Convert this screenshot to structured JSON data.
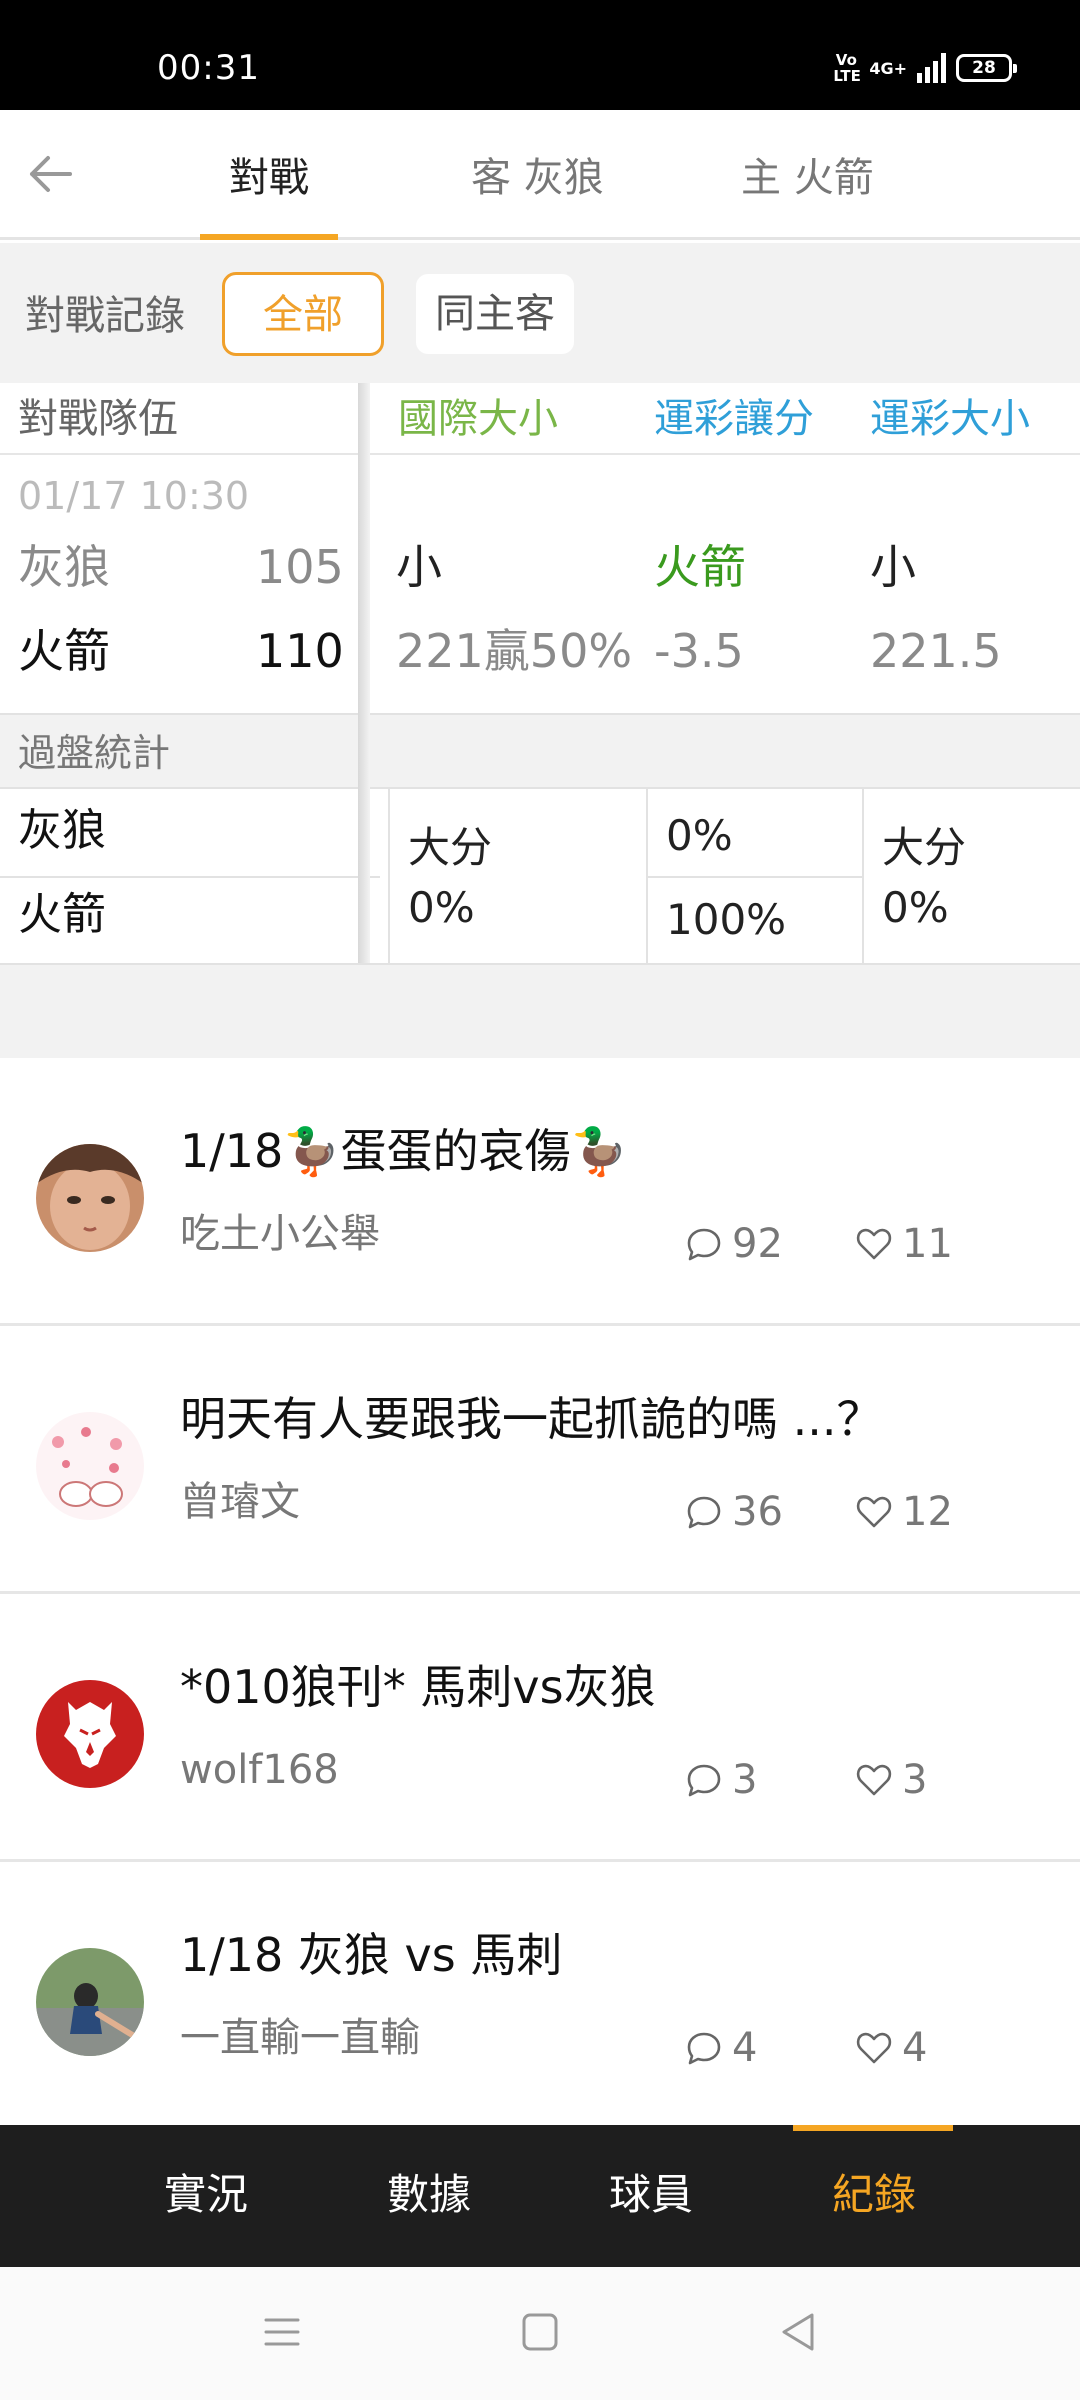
{
  "status_bar": {
    "time": "00:31",
    "volte": "Vo LTE",
    "network": "4G+",
    "battery": "28"
  },
  "header": {
    "tabs": [
      {
        "label": "對戰",
        "active": true
      },
      {
        "label": "客 灰狼",
        "active": false
      },
      {
        "label": "主 火箭",
        "active": false
      }
    ]
  },
  "filters": {
    "label": "對戰記錄",
    "options": [
      {
        "label": "全部",
        "selected": true
      },
      {
        "label": "同主客",
        "selected": false
      }
    ]
  },
  "table": {
    "headers": [
      "對戰隊伍",
      "國際大小",
      "運彩讓分",
      "運彩大小"
    ],
    "game": {
      "date": "01/17 10:30",
      "away": {
        "team": "灰狼",
        "score": "105"
      },
      "home": {
        "team": "火箭",
        "score": "110"
      },
      "intl_ou": {
        "result": "小",
        "line": "221贏50%"
      },
      "spread": {
        "result": "火箭",
        "line": "-3.5"
      },
      "ou": {
        "result": "小",
        "line": "221.5"
      }
    },
    "summary": {
      "title": "過盤統計",
      "teams": [
        "灰狼",
        "火箭"
      ],
      "intl_ou": {
        "label": "大分",
        "pct": "0%"
      },
      "spread": {
        "away_pct": "0%",
        "home_pct": "100%"
      },
      "ou": {
        "label": "大分",
        "pct": "0%"
      }
    }
  },
  "posts": [
    {
      "title": "1/18🦆蛋蛋的哀傷🦆",
      "author": "吃土小公舉",
      "comments": "92",
      "likes": "11"
    },
    {
      "title": "明天有人要跟我一起抓詭的嗎 ...？",
      "author": "曾璿文",
      "comments": "36",
      "likes": "12"
    },
    {
      "title": "*010狼刊* 馬刺vs灰狼",
      "author": "wolf168",
      "comments": "3",
      "likes": "3"
    },
    {
      "title": "1/18 灰狼 vs 馬刺",
      "author": "一直輸一直輸",
      "comments": "4",
      "likes": "4"
    }
  ],
  "bottom_nav": {
    "items": [
      {
        "label": "實況",
        "active": false
      },
      {
        "label": "數據",
        "active": false
      },
      {
        "label": "球員",
        "active": false
      },
      {
        "label": "紀錄",
        "active": true
      }
    ]
  },
  "colors": {
    "accent": "#f5a623",
    "green": "#7ab648",
    "blue": "#2f9fd8",
    "win_green": "#3a9a1e"
  }
}
